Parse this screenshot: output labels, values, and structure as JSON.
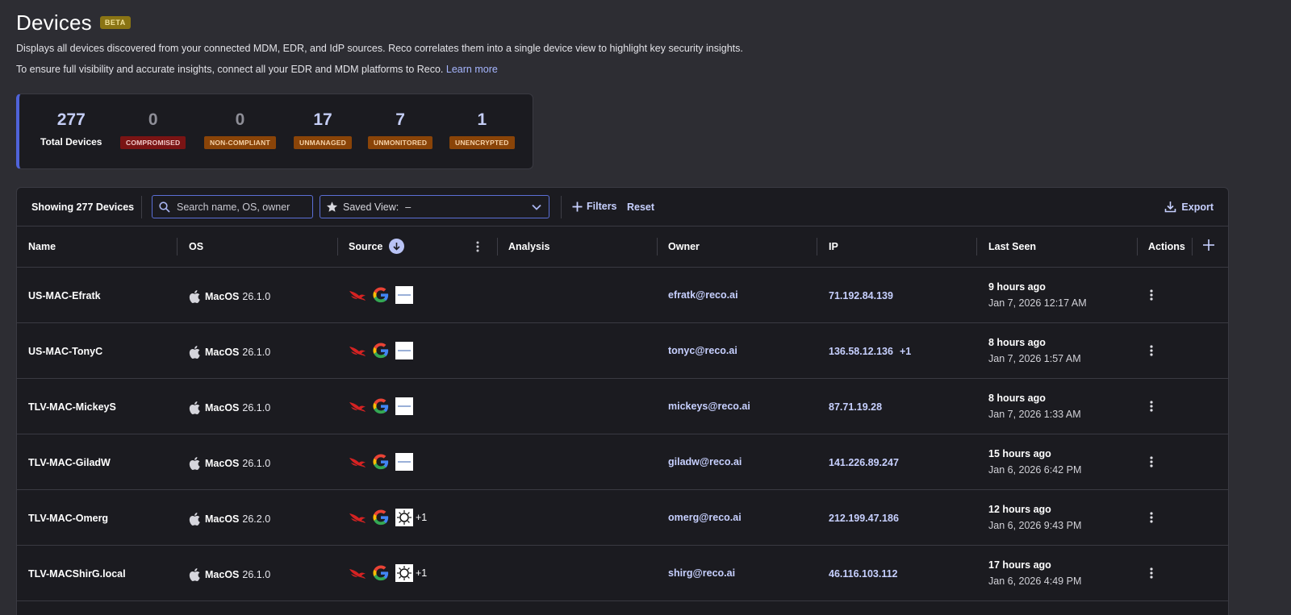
{
  "header": {
    "title": "Devices",
    "badge": "BETA",
    "description": "Displays all devices discovered from your connected MDM, EDR, and IdP sources. Reco correlates them into a single device view to highlight key security insights.",
    "note": "To ensure full visibility and accurate insights, connect all your EDR and MDM platforms to Reco.",
    "learn_more": "Learn more"
  },
  "summary": {
    "total": {
      "value": "277",
      "label": "Total Devices"
    },
    "stats": [
      {
        "value": "0",
        "label": "COMPROMISED",
        "color": "#7a1414"
      },
      {
        "value": "0",
        "label": "NON-COMPLIANT",
        "color": "#8a4408"
      },
      {
        "value": "17",
        "label": "UNMANAGED",
        "color": "#8a4408"
      },
      {
        "value": "7",
        "label": "UNMONITORED",
        "color": "#8a4408"
      },
      {
        "value": "1",
        "label": "UNENCRYPTED",
        "color": "#8a4408"
      }
    ]
  },
  "toolbar": {
    "showing": "Showing 277 Devices",
    "search_placeholder": "Search name, OS, owner",
    "saved_view_label": "Saved View:",
    "saved_view_value": "–",
    "filters": "Filters",
    "reset": "Reset",
    "export": "Export"
  },
  "columns": {
    "name": "Name",
    "os": "OS",
    "source": "Source",
    "analysis": "Analysis",
    "owner": "Owner",
    "ip": "IP",
    "last_seen": "Last Seen",
    "actions": "Actions"
  },
  "rows": [
    {
      "name": "US-MAC-Efratk",
      "os": "MacOS",
      "os_version": "26.1.0",
      "sources": [
        "crowdstrike-icon",
        "google-icon",
        "jamf-icon"
      ],
      "source_extra": "",
      "owner": "efratk@reco.ai",
      "ip": "71.192.84.139",
      "ip_extra": "",
      "last_seen": "9 hours ago",
      "last_seen_date": "Jan 7, 2026 12:17 AM"
    },
    {
      "name": "US-MAC-TonyC",
      "os": "MacOS",
      "os_version": "26.1.0",
      "sources": [
        "crowdstrike-icon",
        "google-icon",
        "jamf-icon"
      ],
      "source_extra": "",
      "owner": "tonyc@reco.ai",
      "ip": "136.58.12.136",
      "ip_extra": "+1",
      "last_seen": "8 hours ago",
      "last_seen_date": "Jan 7, 2026 1:57 AM"
    },
    {
      "name": "TLV-MAC-MickeyS",
      "os": "MacOS",
      "os_version": "26.1.0",
      "sources": [
        "crowdstrike-icon",
        "google-icon",
        "jamf-icon"
      ],
      "source_extra": "",
      "owner": "mickeys@reco.ai",
      "ip": "87.71.19.28",
      "ip_extra": "",
      "last_seen": "8 hours ago",
      "last_seen_date": "Jan 7, 2026 1:33 AM"
    },
    {
      "name": "TLV-MAC-GiladW",
      "os": "MacOS",
      "os_version": "26.1.0",
      "sources": [
        "crowdstrike-icon",
        "google-icon",
        "jamf-icon"
      ],
      "source_extra": "",
      "owner": "giladw@reco.ai",
      "ip": "141.226.89.247",
      "ip_extra": "",
      "last_seen": "15 hours ago",
      "last_seen_date": "Jan 6, 2026 6:42 PM"
    },
    {
      "name": "TLV-MAC-Omerg",
      "os": "MacOS",
      "os_version": "26.2.0",
      "sources": [
        "crowdstrike-icon",
        "google-icon",
        "sunburst-icon"
      ],
      "source_extra": "+1",
      "owner": "omerg@reco.ai",
      "ip": "212.199.47.186",
      "ip_extra": "",
      "last_seen": "12 hours ago",
      "last_seen_date": "Jan 6, 2026 9:43 PM"
    },
    {
      "name": "TLV-MACShirG.local",
      "os": "MacOS",
      "os_version": "26.1.0",
      "sources": [
        "crowdstrike-icon",
        "google-icon",
        "sunburst-icon"
      ],
      "source_extra": "+1",
      "owner": "shirg@reco.ai",
      "ip": "46.116.103.112",
      "ip_extra": "",
      "last_seen": "17 hours ago",
      "last_seen_date": "Jan 6, 2026 4:49 PM"
    }
  ]
}
